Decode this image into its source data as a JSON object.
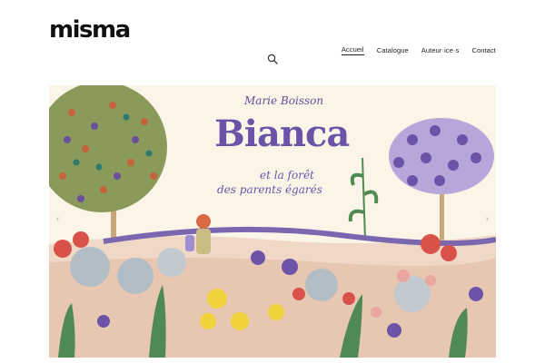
{
  "brand": {
    "logo_text": "misma"
  },
  "nav": {
    "items": [
      {
        "label": "Accueil",
        "active": true
      },
      {
        "label": "Catalogue",
        "active": false
      },
      {
        "label": "Auteur·ice·s",
        "active": false
      },
      {
        "label": "Contact",
        "active": false
      }
    ]
  },
  "search": {
    "icon": "search-icon"
  },
  "hero": {
    "author": "Marie Boisson",
    "title": "Bianca",
    "subtitle_line1": "et la forêt",
    "subtitle_line2": "des parents égarés",
    "prev_icon": "chevron-left-icon",
    "next_icon": "chevron-right-icon",
    "prev_glyph": "‹",
    "next_glyph": "›"
  },
  "colors": {
    "title": "#6c53a8",
    "hero_bg": "#fbf5e8",
    "path": "#7a67b0",
    "tree_crown": "#8a9a5b"
  }
}
